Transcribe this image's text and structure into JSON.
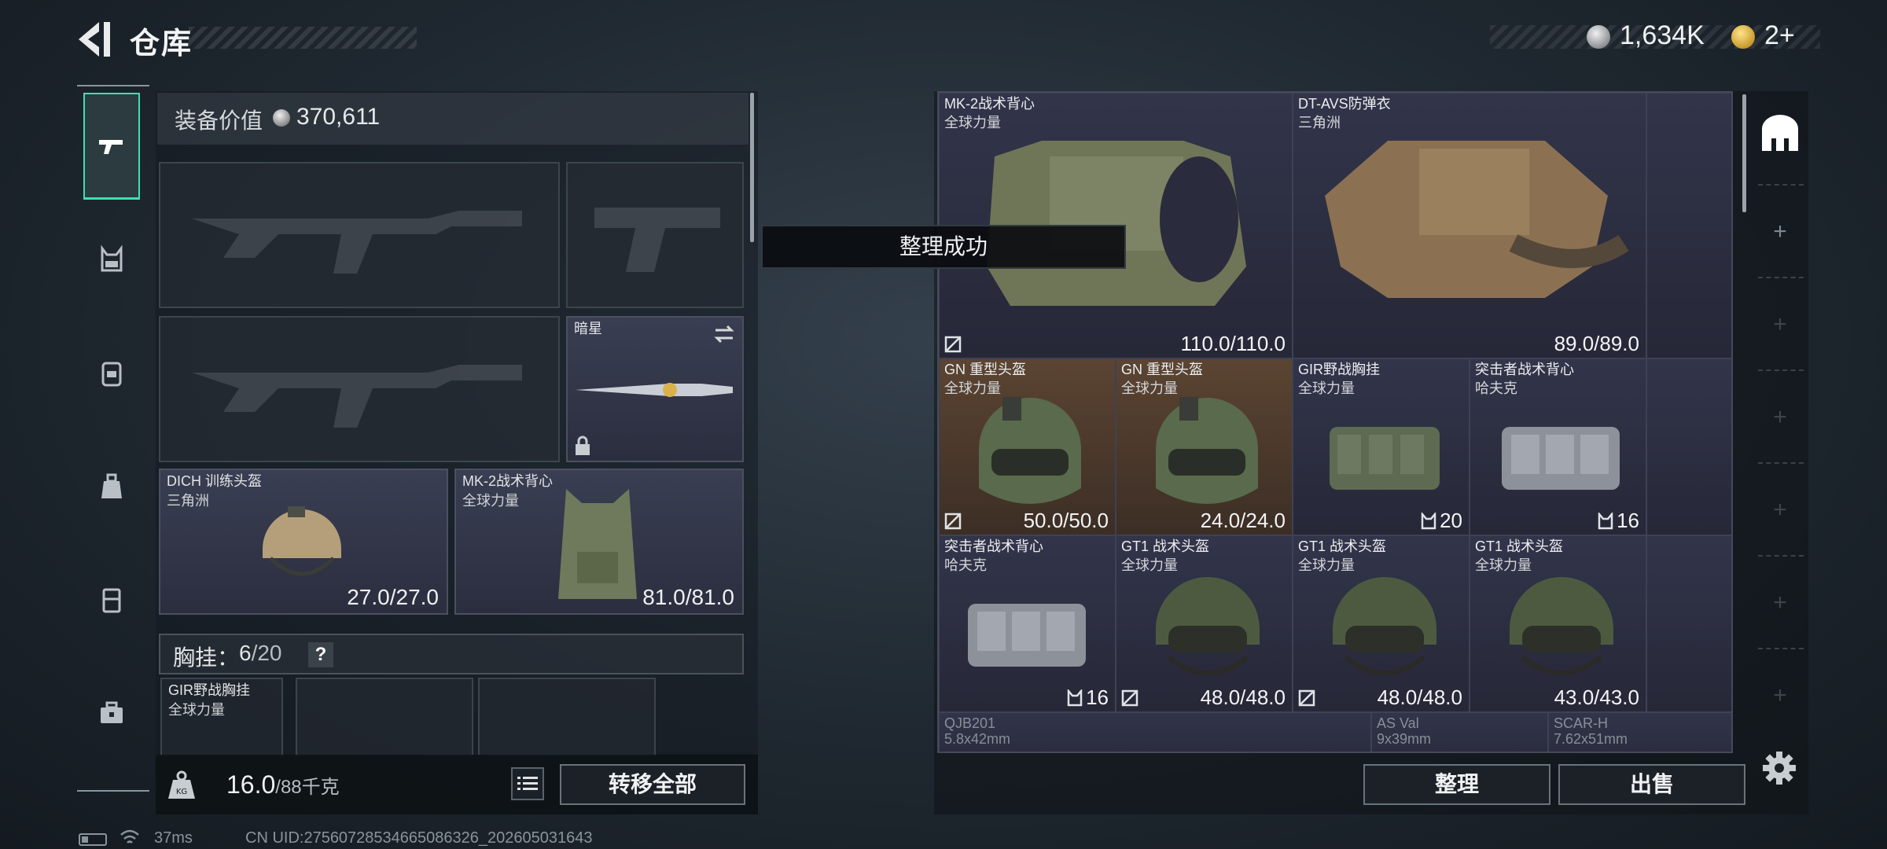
{
  "header": {
    "title": "仓库",
    "currency_primary": "1,634K",
    "currency_secondary": "2+"
  },
  "loadout": {
    "equipment_value_label": "装备价值",
    "equipment_value": "370,611",
    "knife": {
      "name": "暗星"
    },
    "helmet": {
      "name": "DICH 训练头盔",
      "faction": "三角洲",
      "durability": "27.0/27.0"
    },
    "vest": {
      "name": "MK-2战术背心",
      "faction": "全球力量",
      "durability": "81.0/81.0"
    },
    "chest_rig_label": "胸挂：",
    "chest_rig_count": "6",
    "chest_rig_max": "/20",
    "chest_rig_help": "?",
    "rig_slot_item": {
      "name": "GIR野战胸挂",
      "faction": "全球力量"
    },
    "weight_value": "16.0",
    "weight_unit": "/88千克",
    "transfer_all_label": "转移全部"
  },
  "toast": {
    "message": "整理成功"
  },
  "storage": {
    "items": [
      {
        "name": "MK-2战术背心",
        "faction": "全球力量",
        "durability": "110.0/110.0"
      },
      {
        "name": "DT-AVS防弹衣",
        "faction": "三角洲",
        "durability": "89.0/89.0"
      },
      {
        "name": "GN 重型头盔",
        "faction": "全球力量",
        "durability": "50.0/50.0"
      },
      {
        "name": "GN 重型头盔",
        "faction": "全球力量",
        "durability": "24.0/24.0"
      },
      {
        "name": "GIR野战胸挂",
        "faction": "全球力量",
        "capacity": "20"
      },
      {
        "name": "突击者战术背心",
        "faction": "哈夫克",
        "capacity": "16"
      },
      {
        "name": "突击者战术背心",
        "faction": "哈夫克",
        "capacity": "16"
      },
      {
        "name": "GT1 战术头盔",
        "faction": "全球力量",
        "durability": "48.0/48.0"
      },
      {
        "name": "GT1 战术头盔",
        "faction": "全球力量",
        "durability": "48.0/48.0"
      },
      {
        "name": "GT1 战术头盔",
        "faction": "全球力量",
        "durability": "43.0/43.0"
      },
      {
        "name": "QJB201",
        "faction": "5.8x42mm"
      },
      {
        "name": "AS Val",
        "faction": "9x39mm"
      },
      {
        "name": "SCAR-H",
        "faction": "7.62x51mm"
      }
    ],
    "sort_label": "整理",
    "sell_label": "出售"
  },
  "status": {
    "ping": "37ms",
    "uid": "CN UID:275607285346650863​26_202605031643"
  },
  "colors": {
    "accent": "#3fe0b0",
    "highlight_cell": "#5b4432",
    "item_cell": "#32344a"
  },
  "icons": [
    "back-arrow-icon",
    "pistol-icon",
    "vest-icon",
    "backpack-icon",
    "bag-icon",
    "case-icon",
    "toolbox-icon",
    "weight-icon",
    "list-icon",
    "settings-icon",
    "safebox-icon",
    "plus-icon",
    "no-repair-icon",
    "slots-icon"
  ]
}
